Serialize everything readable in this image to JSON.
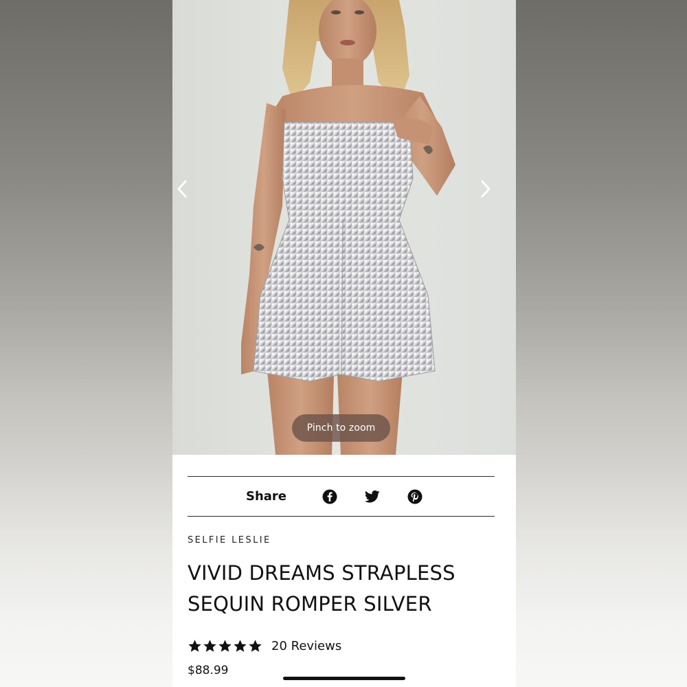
{
  "product_image": {
    "alt": "Model wearing silver strapless sequin romper"
  },
  "gallery": {
    "prev_icon": "chevron-left-icon",
    "next_icon": "chevron-right-icon"
  },
  "zoom_hint": "Pinch to zoom",
  "share": {
    "label": "Share",
    "icons": [
      "facebook-icon",
      "twitter-icon",
      "pinterest-icon"
    ]
  },
  "product": {
    "brand": "SELFIE LESLIE",
    "title": "VIVID DREAMS STRAPLESS SEQUIN ROMPER SILVER",
    "rating": 5,
    "reviews_label": "20 Reviews",
    "price": "$88.99"
  },
  "colors": {
    "text": "#111111",
    "pill": "#6e544a",
    "background": "#ffffff"
  }
}
